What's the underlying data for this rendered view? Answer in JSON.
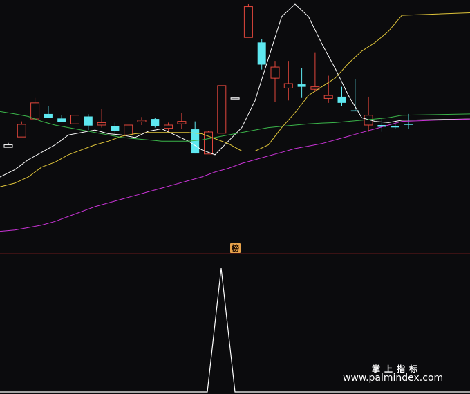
{
  "chart_data": [
    {
      "type": "candlestick",
      "panel": "main",
      "ylim": [
        8.4,
        0
      ],
      "candles": [
        {
          "o": 5.8,
          "h": 5.8,
          "l": 5.62,
          "c": 5.7,
          "dir": "neutral"
        },
        {
          "o": 5.38,
          "h": 5.35,
          "l": 4.75,
          "c": 4.87,
          "dir": "up"
        },
        {
          "o": 4.65,
          "h": 4.05,
          "l": 3.8,
          "c": 4.0,
          "dir": "up"
        },
        {
          "o": 4.45,
          "h": 4.12,
          "l": 4.6,
          "c": 4.6,
          "dir": "down"
        },
        {
          "o": 4.63,
          "h": 4.5,
          "l": 4.77,
          "c": 4.77,
          "dir": "down"
        },
        {
          "o": 4.85,
          "h": 4.45,
          "l": 4.9,
          "c": 4.5,
          "dir": "up"
        },
        {
          "o": 4.55,
          "h": 4.46,
          "l": 5.1,
          "c": 4.92,
          "dir": "down"
        },
        {
          "o": 4.9,
          "h": 4.25,
          "l": 5.0,
          "c": 4.8,
          "dir": "up"
        },
        {
          "o": 4.93,
          "h": 4.8,
          "l": 5.25,
          "c": 5.15,
          "dir": "down"
        },
        {
          "o": 5.3,
          "h": 4.9,
          "l": 5.32,
          "c": 4.9,
          "dir": "up"
        },
        {
          "o": 4.77,
          "h": 4.57,
          "l": 4.9,
          "c": 4.7,
          "dir": "up"
        },
        {
          "o": 4.65,
          "h": 4.6,
          "l": 5.0,
          "c": 4.95,
          "dir": "down"
        },
        {
          "o": 5.03,
          "h": 4.8,
          "l": 5.15,
          "c": 4.9,
          "dir": "up"
        },
        {
          "o": 4.85,
          "h": 4.4,
          "l": 5.05,
          "c": 4.75,
          "dir": "up"
        },
        {
          "o": 5.07,
          "h": 4.75,
          "l": 6.05,
          "c": 6.05,
          "dir": "down"
        },
        {
          "o": 6.07,
          "h": 5.15,
          "l": 6.07,
          "c": 5.18,
          "dir": "up"
        },
        {
          "o": 5.23,
          "h": 3.3,
          "l": 5.23,
          "c": 3.3,
          "dir": "up"
        },
        {
          "o": 3.8,
          "h": 3.8,
          "l": 3.8,
          "c": 3.8,
          "dir": "neutral"
        },
        {
          "o": 1.35,
          "h": 0.0,
          "l": 1.35,
          "c": 0.1,
          "dir": "up"
        },
        {
          "o": 1.55,
          "h": 1.4,
          "l": 2.65,
          "c": 2.45,
          "dir": "down"
        },
        {
          "o": 3.0,
          "h": 2.3,
          "l": 3.95,
          "c": 2.55,
          "dir": "up"
        },
        {
          "o": 3.22,
          "h": 2.3,
          "l": 3.9,
          "c": 3.4,
          "dir": "up"
        },
        {
          "o": 3.25,
          "h": 2.6,
          "l": 3.8,
          "c": 3.35,
          "dir": "down"
        },
        {
          "o": 3.45,
          "h": 1.95,
          "l": 3.55,
          "c": 3.35,
          "dir": "up"
        },
        {
          "o": 3.82,
          "h": 2.9,
          "l": 4.0,
          "c": 3.7,
          "dir": "up"
        },
        {
          "o": 3.75,
          "h": 3.35,
          "l": 4.14,
          "c": 4.0,
          "dir": "down"
        },
        {
          "o": 4.3,
          "h": 3.05,
          "l": 4.34,
          "c": 4.3,
          "dir": "down"
        },
        {
          "o": 4.5,
          "h": 3.75,
          "l": 5.17,
          "c": 4.9,
          "dir": "up"
        },
        {
          "o": 4.97,
          "h": 4.6,
          "l": 5.17,
          "c": 4.9,
          "dir": "down"
        },
        {
          "o": 4.95,
          "h": 4.8,
          "l": 5.05,
          "c": 4.95,
          "dir": "down"
        },
        {
          "o": 4.85,
          "h": 4.45,
          "l": 5.05,
          "c": 4.85,
          "dir": "down"
        }
      ],
      "series": [
        {
          "color": "#ffffff",
          "values": [
            7.0,
            6.7,
            6.3,
            6.0,
            5.7,
            5.3,
            5.2,
            5.1,
            5.25,
            5.3,
            5.4,
            5.15,
            5.05,
            5.3,
            5.55,
            5.9,
            6.1,
            5.55,
            5.0,
            3.9,
            2.2,
            0.5,
            0.0,
            0.5,
            1.6,
            2.6,
            3.7,
            4.6,
            4.75,
            4.8,
            4.7,
            4.65
          ]
        },
        {
          "color": "#e0c53a",
          "values": [
            7.4,
            7.25,
            7.0,
            6.6,
            6.4,
            6.1,
            5.9,
            5.7,
            5.55,
            5.35,
            5.25,
            5.2,
            5.2,
            5.2,
            5.2,
            5.25,
            5.45,
            5.65,
            5.95,
            5.95,
            5.7,
            5.0,
            4.4,
            3.7,
            3.35,
            3.0,
            2.4,
            1.9,
            1.55,
            1.1,
            0.45,
            0.35
          ]
        },
        {
          "color": "#c933d6",
          "values": [
            9.2,
            9.15,
            9.05,
            8.95,
            8.8,
            8.6,
            8.4,
            8.2,
            8.05,
            7.9,
            7.75,
            7.6,
            7.45,
            7.3,
            7.15,
            7.0,
            6.8,
            6.65,
            6.45,
            6.3,
            6.15,
            6.0,
            5.85,
            5.75,
            5.65,
            5.5,
            5.35,
            5.2,
            5.05,
            4.9,
            4.75,
            4.65
          ]
        },
        {
          "color": "#3bb54a",
          "values": [
            4.35,
            4.45,
            4.55,
            4.75,
            4.9,
            5.0,
            5.1,
            5.2,
            5.3,
            5.4,
            5.45,
            5.5,
            5.55,
            5.55,
            5.55,
            5.5,
            5.4,
            5.3,
            5.2,
            5.1,
            5.0,
            4.95,
            4.9,
            4.85,
            4.82,
            4.8,
            4.75,
            4.7,
            4.65,
            4.6,
            4.5,
            4.45
          ]
        }
      ]
    },
    {
      "type": "line",
      "panel": "indicator",
      "ylim": [
        0,
        1
      ],
      "series": [
        {
          "color": "#ffffff",
          "x": [
            0,
            300,
            320,
            340,
            680
          ],
          "values": [
            0,
            0,
            1,
            0,
            0
          ]
        }
      ],
      "marker_label": "榜"
    }
  ],
  "watermark": {
    "cn": "掌上指标",
    "url": "www.palmindex.com"
  },
  "colors": {
    "background": "#0b0b0d",
    "up": "#e2473c",
    "down": "#5ee8f0",
    "divider": "#6b1a1a",
    "badge": "#e7a24a"
  }
}
